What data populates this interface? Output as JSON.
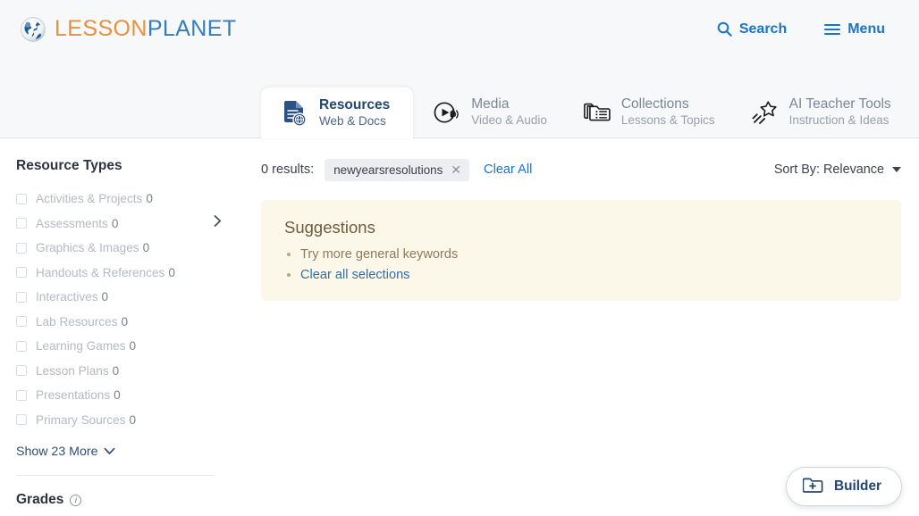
{
  "header": {
    "logo": {
      "part1": "LESSON",
      "part2": "PLANET",
      "icon": "globe-icon"
    },
    "search_label": "Search",
    "search_icon": "search-icon",
    "menu_label": "Menu",
    "menu_icon": "hamburger-menu-icon",
    "link_color": "#1c74c4"
  },
  "tabs": [
    {
      "label": "Resources",
      "sublabel": "Web & Docs",
      "icon": "document-globe-icon",
      "active": true
    },
    {
      "label": "Media",
      "sublabel": "Video & Audio",
      "icon": "play-audio-icon",
      "active": false
    },
    {
      "label": "Collections",
      "sublabel": "Lessons & Topics",
      "icon": "folder-list-icon",
      "active": false
    },
    {
      "label": "AI Teacher Tools",
      "sublabel": "Instruction & Ideas",
      "icon": "magic-star-icon",
      "active": false
    }
  ],
  "sidebar": {
    "resource_types_heading": "Resource Types",
    "facets": [
      {
        "label": "Activities & Projects",
        "count": "0",
        "expandable": false
      },
      {
        "label": "Assessments",
        "count": "0",
        "expandable": true
      },
      {
        "label": "Graphics & Images",
        "count": "0",
        "expandable": false
      },
      {
        "label": "Handouts & References",
        "count": "0",
        "expandable": false
      },
      {
        "label": "Interactives",
        "count": "0",
        "expandable": false
      },
      {
        "label": "Lab Resources",
        "count": "0",
        "expandable": false
      },
      {
        "label": "Learning Games",
        "count": "0",
        "expandable": false
      },
      {
        "label": "Lesson Plans",
        "count": "0",
        "expandable": false
      },
      {
        "label": "Presentations",
        "count": "0",
        "expandable": false
      },
      {
        "label": "Primary Sources",
        "count": "0",
        "expandable": false
      }
    ],
    "show_more_label": "Show 23 More",
    "show_more_icon": "chevron-down-icon",
    "grades_heading": "Grades",
    "grades_info_icon": "info-icon"
  },
  "results": {
    "count_text": "0 results:",
    "chip": {
      "label": "newyearsresolutions",
      "remove_icon": "close-icon"
    },
    "clear_all_label": "Clear All",
    "sort_label": "Sort By: Relevance",
    "sort_icon": "caret-down-icon"
  },
  "suggestions": {
    "title": "Suggestions",
    "items": [
      {
        "text": "Try more general keywords",
        "is_link": false
      },
      {
        "text": "Clear all selections",
        "is_link": true
      }
    ],
    "background": "#fcf8e9"
  },
  "builder": {
    "label": "Builder",
    "icon": "folder-plus-icon"
  }
}
